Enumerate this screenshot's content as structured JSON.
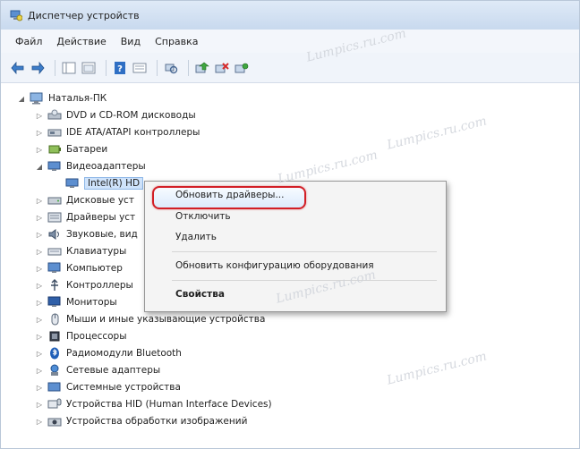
{
  "window": {
    "title": "Диспетчер устройств"
  },
  "menu": [
    "Файл",
    "Действие",
    "Вид",
    "Справка"
  ],
  "toolbar": {
    "icons": [
      "back-icon",
      "forward-icon",
      "properties-pane-icon",
      "show-hide-icon",
      "help-icon",
      "view-icon",
      "scan-icon",
      "update-driver-icon",
      "disable-icon",
      "rollback-icon"
    ]
  },
  "tree": {
    "root": "Наталья-ПК",
    "items": [
      "DVD и CD-ROM дисководы",
      "IDE ATA/ATAPI контроллеры",
      "Батареи",
      "Видеоадаптеры",
      "Intel(R) HD",
      "Дисковые уст",
      "Драйверы уст",
      "Звуковые, вид",
      "Клавиатуры",
      "Компьютер",
      "Контроллеры",
      "Мониторы",
      "Мыши и иные указывающие устройства",
      "Процессоры",
      "Радиомодули Bluetooth",
      "Сетевые адаптеры",
      "Системные устройства",
      "Устройства HID (Human Interface Devices)",
      "Устройства обработки изображений"
    ]
  },
  "context_menu": {
    "update": "Обновить драйверы...",
    "disable": "Отключить",
    "delete": "Удалить",
    "scan": "Обновить конфигурацию оборудования",
    "properties": "Свойства"
  },
  "watermark": "Lumpics.ru.com"
}
